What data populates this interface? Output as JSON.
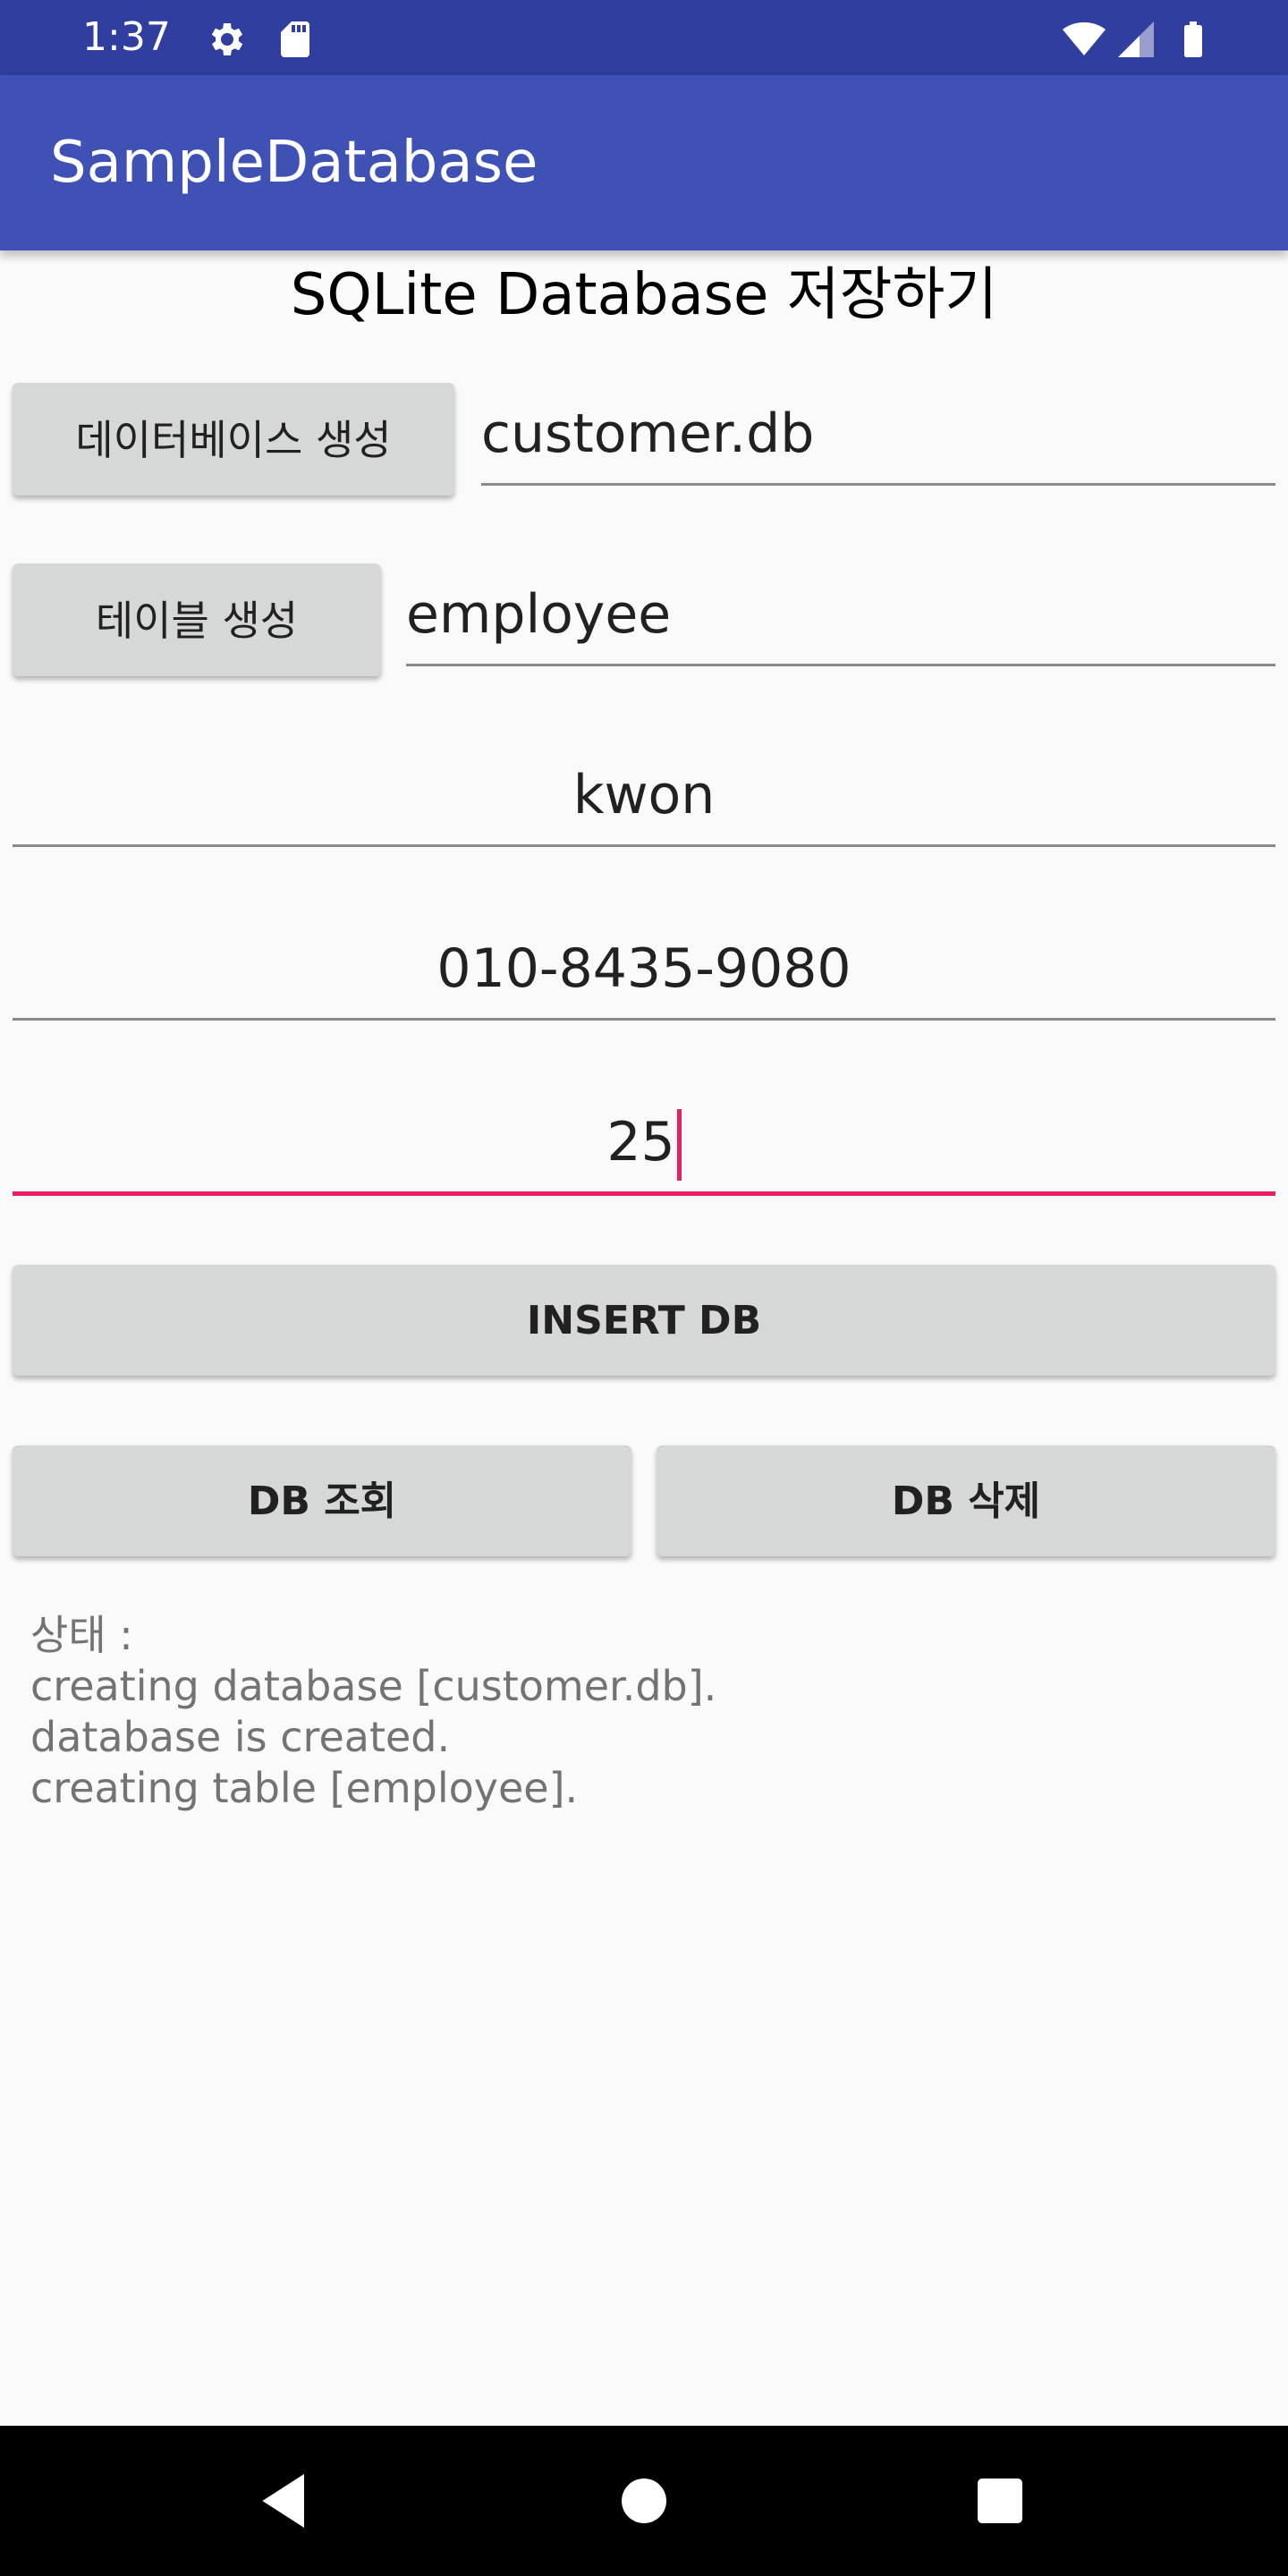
{
  "status_bar": {
    "time": "1:37",
    "icons": [
      "gear-icon",
      "sd-card-icon",
      "wifi-icon",
      "signal-icon",
      "battery-icon"
    ]
  },
  "app_bar": {
    "title": "SampleDatabase"
  },
  "main": {
    "title": "SQLite Database 저장하기",
    "create_db_button": "데이터베이스 생성",
    "db_name_value": "customer.db",
    "create_table_button": "테이블 생성",
    "table_name_value": "employee",
    "name_value": "kwon",
    "phone_value": "010-8435-9080",
    "age_value": "25",
    "insert_button": "INSERT DB",
    "query_button": "DB 조회",
    "delete_button": "DB 삭제",
    "status_text": "상태 :\ncreating database [customer.db].\ndatabase is created.\ncreating table [employee]."
  },
  "colors": {
    "status_bar": "#303f9f",
    "app_bar": "#3f51b5",
    "accent": "#e91e63",
    "button": "#d6d7d7"
  },
  "nav_bar": {
    "icons": [
      "back-icon",
      "home-icon",
      "recents-icon"
    ]
  }
}
